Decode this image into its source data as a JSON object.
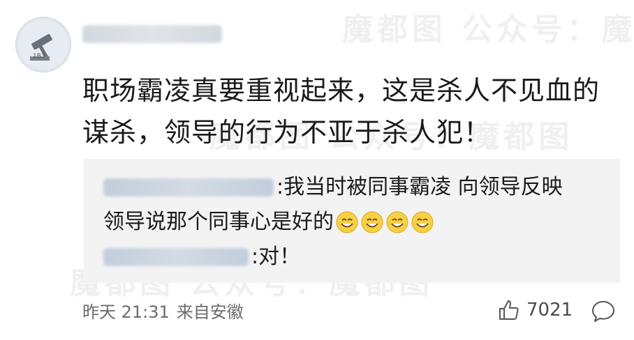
{
  "comment": {
    "main_line1": "职场霸凌真要重视起来，这是杀人不见血的",
    "main_line2": "谋杀，领导的行为不亚于杀人犯！",
    "replies": [
      {
        "text": ":我当时被同事霸凌 向领导反映"
      },
      {
        "text": "领导说那个同事心是好的"
      },
      {
        "text": ":对！"
      }
    ],
    "timestamp": "昨天 21:31",
    "source": "来自安徽",
    "likes": "7021"
  },
  "watermark_text": "魔都图 公众号：魔都图",
  "icons": [
    "avatar",
    "smile-emoji-icon",
    "thumbs-up-icon",
    "comment-icon"
  ],
  "colors": {
    "reply_background": "#f3f3f3",
    "meta_text": "#6b6b6b"
  }
}
